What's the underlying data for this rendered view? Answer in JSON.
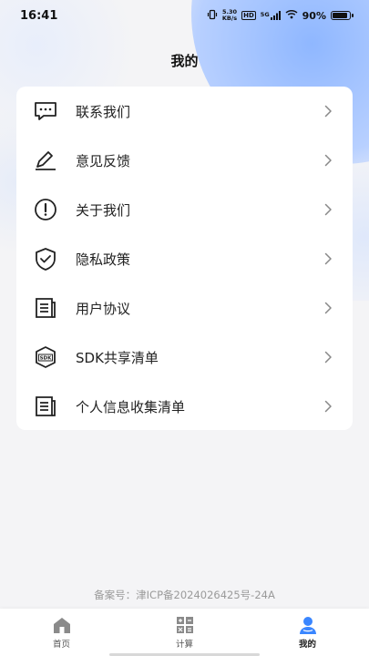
{
  "status_bar": {
    "time": "16:41",
    "net_speed_value": "5.30",
    "net_speed_unit": "KB/s",
    "hd": "HD",
    "signal": "5G",
    "battery_percent": "90%",
    "battery_level": 0.9
  },
  "header": {
    "title": "我的"
  },
  "menu": {
    "items": [
      {
        "label": "联系我们",
        "icon": "chat-bubble-icon"
      },
      {
        "label": "意见反馈",
        "icon": "edit-pen-icon"
      },
      {
        "label": "关于我们",
        "icon": "info-exclamation-icon"
      },
      {
        "label": "隐私政策",
        "icon": "shield-check-icon"
      },
      {
        "label": "用户协议",
        "icon": "document-list-icon"
      },
      {
        "label": "SDK共享清单",
        "icon": "sdk-box-icon"
      },
      {
        "label": "个人信息收集清单",
        "icon": "document-list-icon"
      }
    ]
  },
  "footer": {
    "icp": "备案号：津ICP备2024026425号-24A"
  },
  "tabbar": {
    "tabs": [
      {
        "label": "首页",
        "icon": "home-icon"
      },
      {
        "label": "计算",
        "icon": "calculator-icon"
      },
      {
        "label": "我的",
        "icon": "user-icon",
        "active": true
      }
    ]
  },
  "colors": {
    "accent": "#3a86ff",
    "background": "#f4f4f6"
  }
}
